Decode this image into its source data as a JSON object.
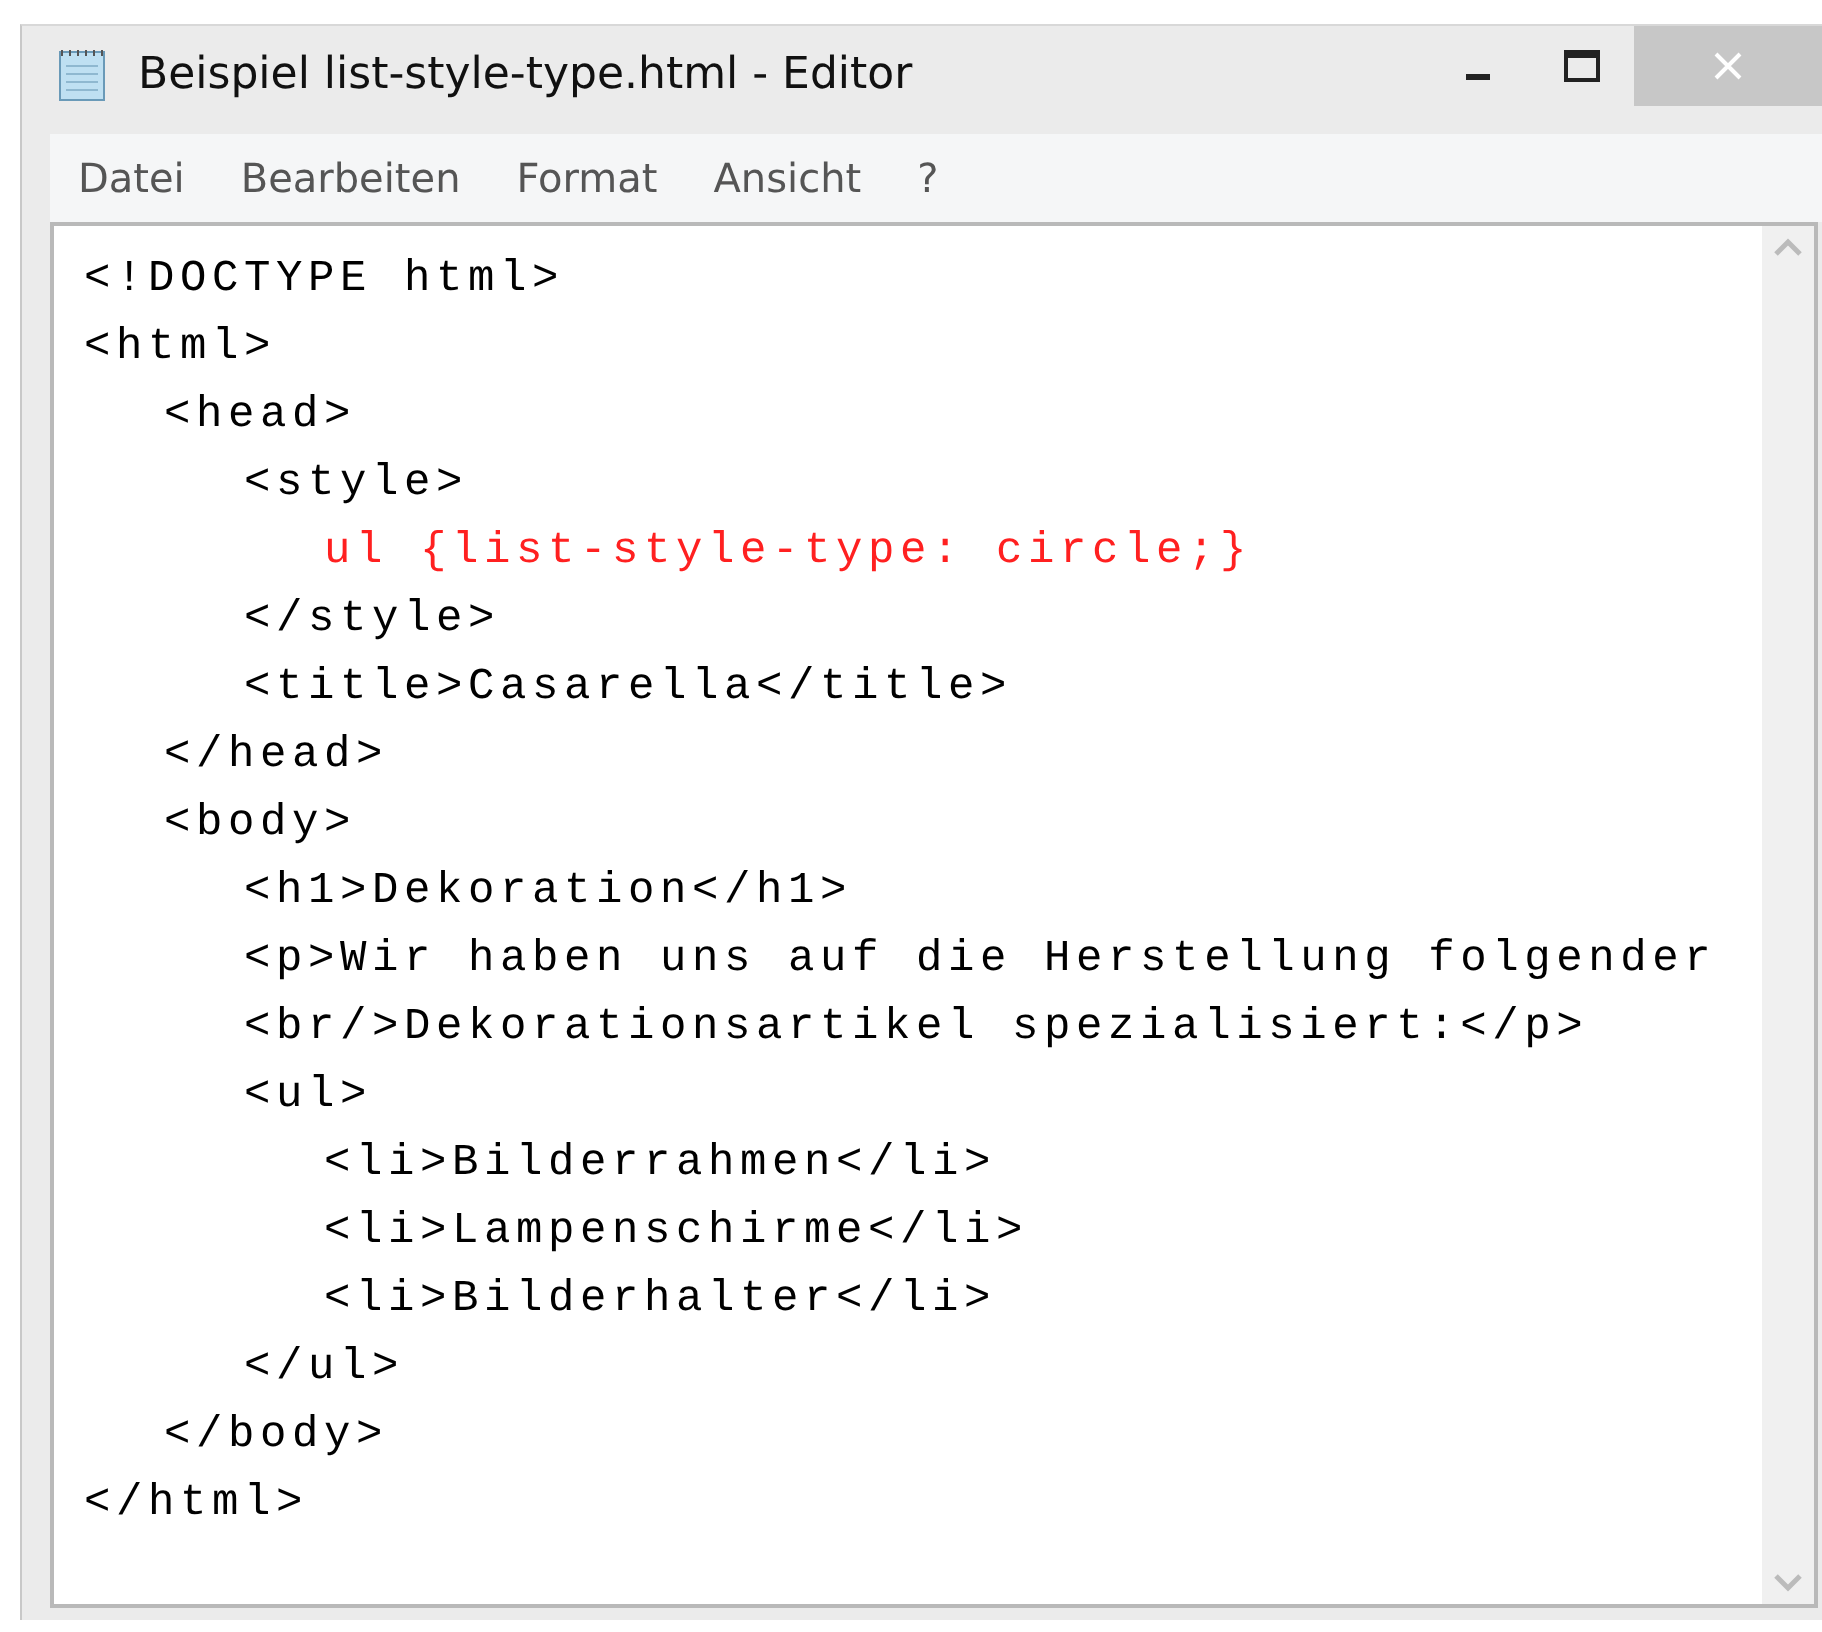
{
  "window": {
    "title": "Beispiel list-style-type.html - Editor"
  },
  "menu": [
    "Datei",
    "Bearbeiten",
    "Format",
    "Ansicht",
    "?"
  ],
  "editor": {
    "lines": [
      {
        "text": "<!DOCTYPE html>"
      },
      {
        "text": "<html>",
        "children": [
          {
            "text": "<head>",
            "children": [
              {
                "text": "<style>",
                "children": [
                  {
                    "text": "ul {list-style-type: circle;}",
                    "color": "#ff2020"
                  }
                ]
              },
              {
                "text": "</style>"
              },
              {
                "text": "<title>Casarella</title>"
              }
            ]
          },
          {
            "text": "</head>"
          },
          {
            "text": "<body>",
            "children": [
              {
                "text": "<h1>Dekoration</h1>"
              },
              {
                "text": "<p>Wir haben uns auf die Herstellung folgender"
              },
              {
                "text": "<br/>Dekorationsartikel spezialisiert:</p>"
              },
              {
                "text": "<ul>",
                "children": [
                  {
                    "text": "<li>Bilderrahmen</li>"
                  },
                  {
                    "text": "<li>Lampenschirme</li>"
                  },
                  {
                    "text": "<li>Bilderhalter</li>"
                  }
                ]
              },
              {
                "text": "</ul>"
              }
            ]
          },
          {
            "text": "</body>"
          }
        ]
      },
      {
        "text": "</html>"
      }
    ]
  }
}
